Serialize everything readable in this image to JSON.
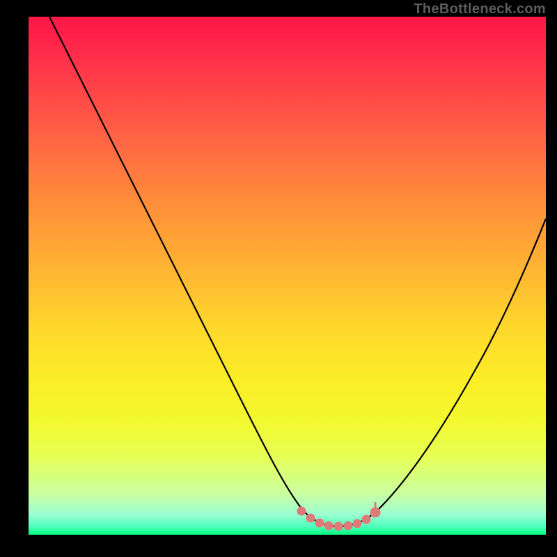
{
  "attribution": "TheBottleneck.com",
  "chart_data": {
    "type": "line",
    "title": "",
    "xlabel": "",
    "ylabel": "",
    "xlim": [
      0,
      100
    ],
    "ylim": [
      0,
      100
    ],
    "series": [
      {
        "name": "curve",
        "x": [
          4,
          10,
          15,
          20,
          25,
          30,
          35,
          40,
          45,
          50,
          52,
          54,
          56,
          58,
          60,
          62,
          64,
          66,
          68,
          70,
          72,
          75,
          80,
          85,
          90,
          95,
          100
        ],
        "y": [
          100,
          88,
          78,
          68,
          58,
          48,
          38,
          28,
          19,
          10,
          7,
          5,
          3.5,
          2.5,
          2,
          2,
          2,
          2.5,
          3.5,
          5,
          7,
          11,
          19,
          29,
          40,
          52,
          65
        ]
      },
      {
        "name": "flat-markers",
        "x": [
          54,
          56,
          58,
          60,
          62,
          64,
          66,
          68,
          70
        ],
        "y": [
          4,
          3,
          2.5,
          2.3,
          2.3,
          2.5,
          3,
          4,
          5
        ]
      }
    ],
    "colors": {
      "curve": "#000000",
      "markers": "#e07a78"
    }
  }
}
